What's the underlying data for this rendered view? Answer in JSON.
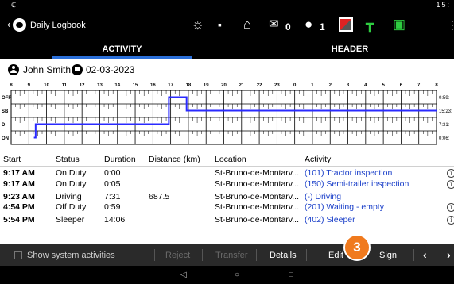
{
  "status_bar": {
    "left_icon": "c-icon",
    "right_text": "15:"
  },
  "app": {
    "title": "Daily Logbook",
    "messages_count": "0",
    "users_count": "1"
  },
  "tabs": [
    {
      "label": "ACTIVITY"
    },
    {
      "label": "HEADER"
    }
  ],
  "driver": {
    "name": "John Smith",
    "date": "02-03-2023"
  },
  "graph": {
    "hour_labels": [
      "8",
      "9",
      "10",
      "11",
      "12",
      "13",
      "14",
      "15",
      "16",
      "17",
      "18",
      "19",
      "20",
      "21",
      "22",
      "23",
      "0",
      "1",
      "2",
      "3",
      "4",
      "5",
      "6",
      "7",
      "8"
    ],
    "status_labels": [
      "OFF",
      "SB",
      "D",
      "ON"
    ],
    "totals": [
      "0:59:",
      "15:23:",
      "7:31:",
      "0:06:"
    ],
    "line_color": "#2a2aff"
  },
  "table": {
    "headers": {
      "start": "Start",
      "status": "Status",
      "duration": "Duration",
      "distance": "Distance (km)",
      "location": "Location",
      "activity": "Activity"
    },
    "rows": [
      {
        "start": "9:17 AM",
        "status": "On Duty",
        "duration": "0:00",
        "distance": "",
        "location": "St-Bruno-de-Montarv...",
        "activity": "(101) Tractor inspection"
      },
      {
        "start": "9:17 AM",
        "status": "On Duty",
        "duration": "0:05",
        "distance": "",
        "location": "St-Bruno-de-Montarv...",
        "activity": "(150) Semi-trailer inspection"
      },
      {
        "start": "9:23 AM",
        "status": "Driving",
        "duration": "7:31",
        "distance": "687.5",
        "location": "St-Bruno-de-Montarv...",
        "activity": "(-) Driving"
      },
      {
        "start": "4:54 PM",
        "status": "Off Duty",
        "duration": "0:59",
        "distance": "",
        "location": "St-Bruno-de-Montarv...",
        "activity": "(201) Waiting - empty"
      },
      {
        "start": "5:54 PM",
        "status": "Sleeper",
        "duration": "14:06",
        "distance": "",
        "location": "St-Bruno-de-Montarv...",
        "activity": "(402) Sleeper"
      }
    ]
  },
  "actions": {
    "show_system": "Show system activities",
    "reject": "Reject",
    "transfer": "Transfer",
    "details": "Details",
    "edit": "Edit",
    "sign": "Sign"
  },
  "badge": "3",
  "colors": {
    "tab_indicator": "#2b6fd8",
    "activity_link": "#1a3fc9",
    "badge": "#f07a1e"
  }
}
